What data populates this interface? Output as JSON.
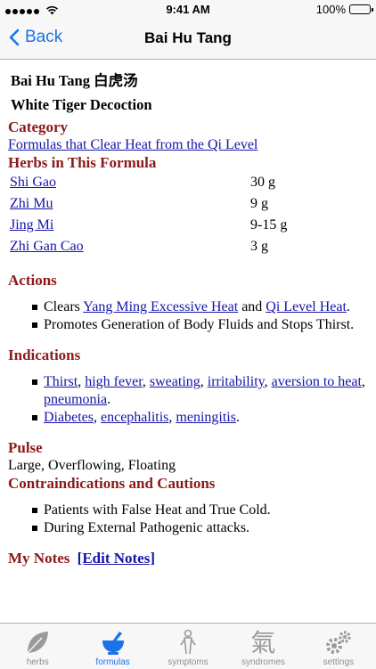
{
  "status": {
    "time": "9:41 AM",
    "battery": "100%"
  },
  "nav": {
    "back_label": "Back",
    "title": "Bai Hu Tang"
  },
  "formula": {
    "name_line": "Bai Hu Tang 白虎汤",
    "english_name": "White Tiger Decoction"
  },
  "sections": {
    "category": "Category",
    "herbs": "Herbs in This Formula",
    "actions": "Actions",
    "indications": "Indications",
    "pulse": "Pulse",
    "contraindications": "Contraindications and Cautions",
    "my_notes": "My Notes",
    "edit_notes": "[Edit Notes]"
  },
  "category_link": "Formulas that Clear Heat from the Qi Level",
  "herbs": [
    {
      "name": "Shi Gao",
      "dose": "30 g"
    },
    {
      "name": "Zhi Mu",
      "dose": "9 g"
    },
    {
      "name": "Jing Mi",
      "dose": "9-15 g"
    },
    {
      "name": "Zhi Gan Cao",
      "dose": "3 g"
    }
  ],
  "actions": {
    "a1_pre": "Clears ",
    "a1_link1": "Yang Ming Excessive Heat",
    "a1_mid": " and ",
    "a1_link2": "Qi Level Heat",
    "a1_post": ".",
    "a2": "Promotes Generation of Body Fluids and Stops Thirst."
  },
  "indications": {
    "i1": [
      "Thirst",
      "high fever",
      "sweating",
      "irritability",
      "aversion to heat",
      "pneumonia"
    ],
    "i2": [
      "Diabetes",
      "encephalitis",
      "meningitis"
    ]
  },
  "pulse_text": "Large, Overflowing, Floating",
  "contraindications": [
    "Patients with False Heat and True Cold.",
    "During External Pathogenic attacks."
  ],
  "tabs": [
    {
      "label": "herbs"
    },
    {
      "label": "formulas"
    },
    {
      "label": "symptoms"
    },
    {
      "label": "syndromes",
      "glyph": "氣"
    },
    {
      "label": "settings"
    }
  ],
  "colors": {
    "accent": "#1a73e8",
    "section_heading": "#8b1a1a",
    "link": "#1515a8"
  }
}
